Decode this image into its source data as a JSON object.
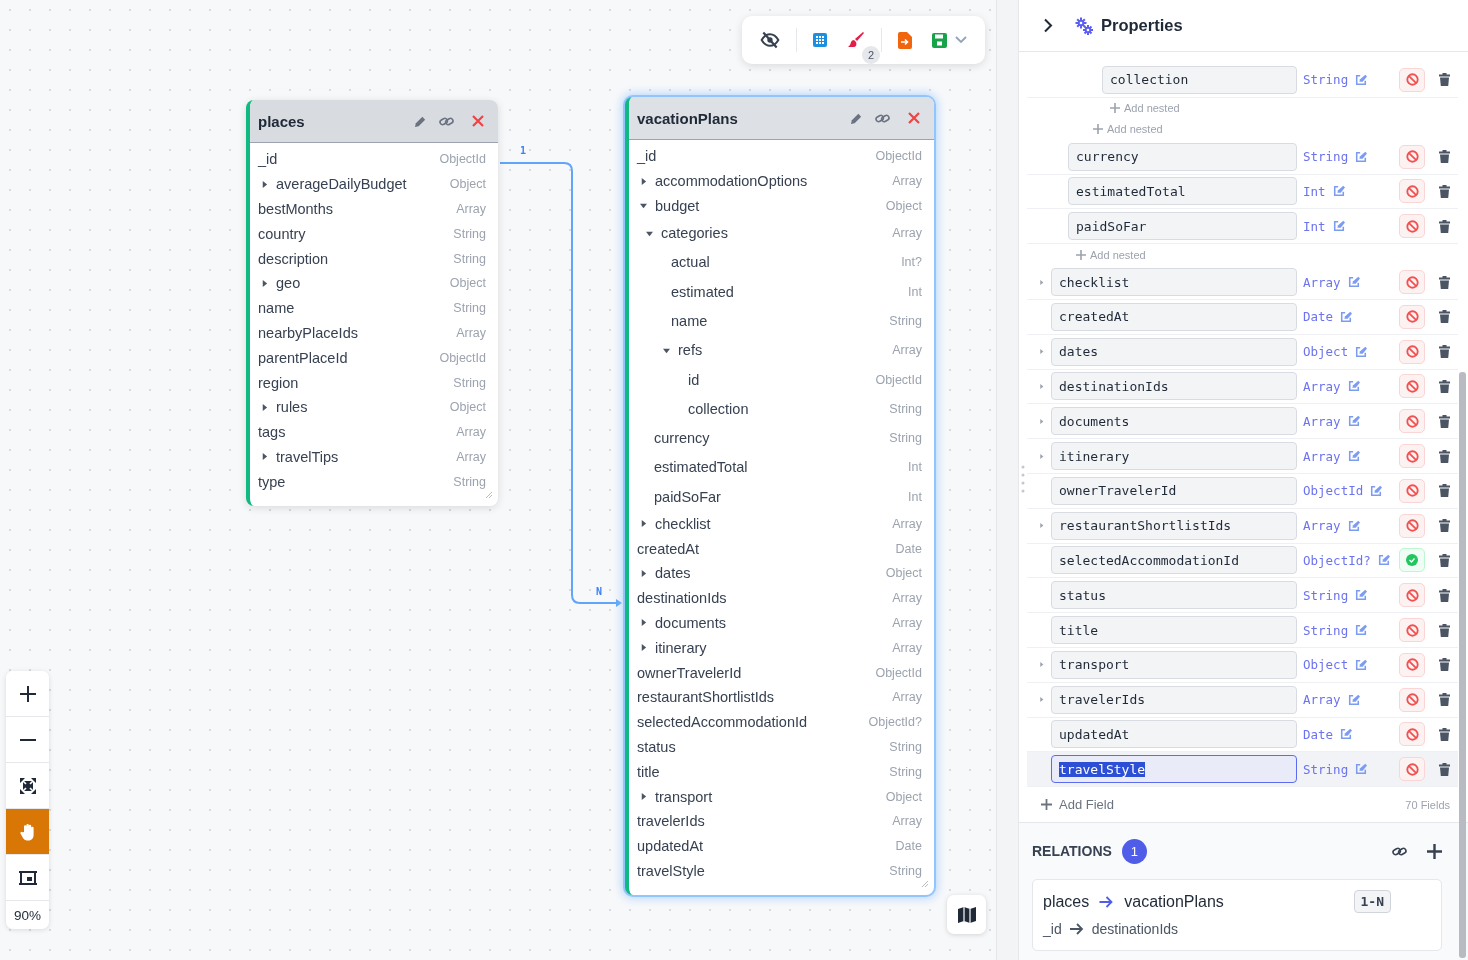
{
  "canvas": {
    "toolbar": {
      "cleanup_badge": "2"
    },
    "entities": [
      {
        "name": "places",
        "selected": false,
        "fields": [
          {
            "name": "_id",
            "type": "ObjectId"
          },
          {
            "name": "averageDailyBudget",
            "type": "Object",
            "expanded": false
          },
          {
            "name": "bestMonths",
            "type": "Array"
          },
          {
            "name": "country",
            "type": "String"
          },
          {
            "name": "description",
            "type": "String"
          },
          {
            "name": "geo",
            "type": "Object",
            "expanded": false
          },
          {
            "name": "name",
            "type": "String"
          },
          {
            "name": "nearbyPlaceIds",
            "type": "Array"
          },
          {
            "name": "parentPlaceId",
            "type": "ObjectId"
          },
          {
            "name": "region",
            "type": "String"
          },
          {
            "name": "rules",
            "type": "Object",
            "expanded": false
          },
          {
            "name": "tags",
            "type": "Array"
          },
          {
            "name": "travelTips",
            "type": "Array",
            "expanded": false
          },
          {
            "name": "type",
            "type": "String"
          }
        ]
      },
      {
        "name": "vacationPlans",
        "selected": true,
        "fields": [
          {
            "name": "_id",
            "type": "ObjectId"
          },
          {
            "name": "accommodationOptions",
            "type": "Array",
            "expanded": false
          },
          {
            "name": "budget",
            "type": "Object",
            "expanded": true,
            "children": [
              {
                "name": "categories",
                "type": "Array",
                "expanded": true,
                "children": [
                  {
                    "name": "actual",
                    "type": "Int?"
                  },
                  {
                    "name": "estimated",
                    "type": "Int"
                  },
                  {
                    "name": "name",
                    "type": "String"
                  },
                  {
                    "name": "refs",
                    "type": "Array",
                    "expanded": true,
                    "children": [
                      {
                        "name": "id",
                        "type": "ObjectId"
                      },
                      {
                        "name": "collection",
                        "type": "String"
                      }
                    ]
                  }
                ]
              },
              {
                "name": "currency",
                "type": "String"
              },
              {
                "name": "estimatedTotal",
                "type": "Int"
              },
              {
                "name": "paidSoFar",
                "type": "Int"
              }
            ]
          },
          {
            "name": "checklist",
            "type": "Array",
            "expanded": false
          },
          {
            "name": "createdAt",
            "type": "Date"
          },
          {
            "name": "dates",
            "type": "Object",
            "expanded": false
          },
          {
            "name": "destinationIds",
            "type": "Array"
          },
          {
            "name": "documents",
            "type": "Array",
            "expanded": false
          },
          {
            "name": "itinerary",
            "type": "Array",
            "expanded": false
          },
          {
            "name": "ownerTravelerId",
            "type": "ObjectId"
          },
          {
            "name": "restaurantShortlistIds",
            "type": "Array"
          },
          {
            "name": "selectedAccommodationId",
            "type": "ObjectId?"
          },
          {
            "name": "status",
            "type": "String"
          },
          {
            "name": "title",
            "type": "String"
          },
          {
            "name": "transport",
            "type": "Object",
            "expanded": false
          },
          {
            "name": "travelerIds",
            "type": "Array"
          },
          {
            "name": "updatedAt",
            "type": "Date"
          },
          {
            "name": "travelStyle",
            "type": "String"
          }
        ]
      }
    ],
    "relations": [
      {
        "from_label": "1",
        "to_label": "N"
      }
    ],
    "zoom": {
      "tools": [
        {
          "kind": "zoom_in",
          "selected": false
        },
        {
          "kind": "zoom_out",
          "selected": false
        },
        {
          "kind": "fit",
          "selected": false
        },
        {
          "kind": "pan",
          "selected": true
        },
        {
          "kind": "frame",
          "selected": false
        }
      ],
      "level": "90%"
    }
  },
  "panel": {
    "title": "Properties",
    "rows": [
      {
        "kind": "group",
        "children": [
          {
            "kind": "group",
            "children": [
              {
                "kind": "group",
                "children": [
                  {
                    "kind": "field",
                    "name": "collection",
                    "type": "String",
                    "expandable": false,
                    "optional": false,
                    "selected": false
                  },
                  {
                    "kind": "add",
                    "label": "Add nested"
                  }
                ]
              },
              {
                "kind": "add",
                "label": "Add nested"
              }
            ]
          },
          {
            "kind": "field",
            "name": "currency",
            "type": "String",
            "expandable": false,
            "optional": false,
            "selected": false
          },
          {
            "kind": "field",
            "name": "estimatedTotal",
            "type": "Int",
            "expandable": false,
            "optional": false,
            "selected": false
          },
          {
            "kind": "field",
            "name": "paidSoFar",
            "type": "Int",
            "expandable": false,
            "optional": false,
            "selected": false
          },
          {
            "kind": "add",
            "label": "Add nested"
          }
        ]
      },
      {
        "kind": "field",
        "name": "checklist",
        "type": "Array",
        "expandable": true,
        "optional": false,
        "selected": false
      },
      {
        "kind": "field",
        "name": "createdAt",
        "type": "Date",
        "expandable": false,
        "optional": false,
        "selected": false
      },
      {
        "kind": "field",
        "name": "dates",
        "type": "Object",
        "expandable": true,
        "optional": false,
        "selected": false
      },
      {
        "kind": "field",
        "name": "destinationIds",
        "type": "Array",
        "expandable": true,
        "optional": false,
        "selected": false
      },
      {
        "kind": "field",
        "name": "documents",
        "type": "Array",
        "expandable": true,
        "optional": false,
        "selected": false
      },
      {
        "kind": "field",
        "name": "itinerary",
        "type": "Array",
        "expandable": true,
        "optional": false,
        "selected": false
      },
      {
        "kind": "field",
        "name": "ownerTravelerId",
        "type": "ObjectId",
        "expandable": false,
        "optional": false,
        "selected": false
      },
      {
        "kind": "field",
        "name": "restaurantShortlistIds",
        "type": "Array",
        "expandable": true,
        "optional": false,
        "selected": false
      },
      {
        "kind": "field",
        "name": "selectedAccommodationId",
        "type": "ObjectId?",
        "expandable": false,
        "optional": true,
        "selected": false
      },
      {
        "kind": "field",
        "name": "status",
        "type": "String",
        "expandable": false,
        "optional": false,
        "selected": false
      },
      {
        "kind": "field",
        "name": "title",
        "type": "String",
        "expandable": false,
        "optional": false,
        "selected": false
      },
      {
        "kind": "field",
        "name": "transport",
        "type": "Object",
        "expandable": true,
        "optional": false,
        "selected": false
      },
      {
        "kind": "field",
        "name": "travelerIds",
        "type": "Array",
        "expandable": true,
        "optional": false,
        "selected": false
      },
      {
        "kind": "field",
        "name": "updatedAt",
        "type": "Date",
        "expandable": false,
        "optional": false,
        "selected": false
      },
      {
        "kind": "field",
        "name": "travelStyle",
        "type": "String",
        "expandable": false,
        "optional": false,
        "selected": true
      }
    ],
    "add_field": "Add Field",
    "field_count": "70 Fields",
    "relations": {
      "title": "RELATIONS",
      "count": "1",
      "items": [
        {
          "from": "places",
          "to": "vacationPlans",
          "cardinality": "1-N",
          "from_field": "_id",
          "to_field": "destinationIds"
        }
      ]
    }
  }
}
